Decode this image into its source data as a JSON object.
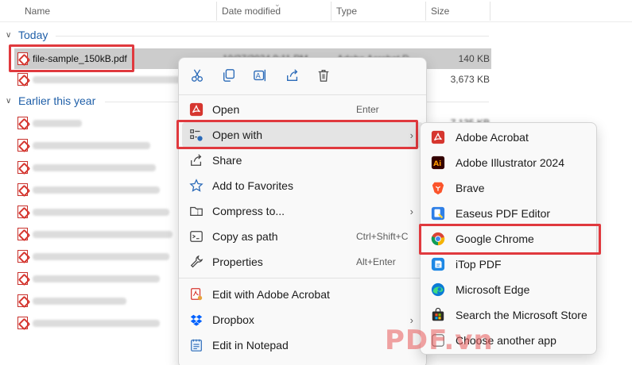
{
  "columns": {
    "name": "Name",
    "date_modified": "Date modified",
    "type": "Type",
    "size": "Size"
  },
  "groups": {
    "today": "Today",
    "earlier": "Earlier this year"
  },
  "files": {
    "selected_name": "file-sample_150kB.pdf",
    "selected_date": "10/27/2024 9:11 PM",
    "selected_type": "Adobe Acrobat D",
    "selected_size": "140 KB",
    "second_size": "3,673 KB",
    "third_size": "7,135 KB"
  },
  "quick_actions": [
    "cut-icon",
    "copy-icon",
    "rename-icon",
    "share-icon",
    "delete-icon"
  ],
  "menu": {
    "open": {
      "label": "Open",
      "shortcut": "Enter"
    },
    "open_with": {
      "label": "Open with"
    },
    "share": {
      "label": "Share"
    },
    "add_favorites": {
      "label": "Add to Favorites"
    },
    "compress": {
      "label": "Compress to..."
    },
    "copy_path": {
      "label": "Copy as path",
      "shortcut": "Ctrl+Shift+C"
    },
    "properties": {
      "label": "Properties",
      "shortcut": "Alt+Enter"
    },
    "edit_acrobat": {
      "label": "Edit with Adobe Acrobat"
    },
    "dropbox": {
      "label": "Dropbox"
    },
    "notepad": {
      "label": "Edit in Notepad"
    }
  },
  "submenu": {
    "items": [
      {
        "label": "Adobe Acrobat",
        "icon": "adobe-acrobat-icon"
      },
      {
        "label": "Adobe Illustrator 2024",
        "icon": "adobe-illustrator-icon"
      },
      {
        "label": "Brave",
        "icon": "brave-icon"
      },
      {
        "label": "Easeus PDF Editor",
        "icon": "easeus-pdf-icon"
      },
      {
        "label": "Google Chrome",
        "icon": "chrome-icon"
      },
      {
        "label": "iTop PDF",
        "icon": "itop-pdf-icon"
      },
      {
        "label": "Microsoft Edge",
        "icon": "edge-icon"
      },
      {
        "label": "Search the Microsoft Store",
        "icon": "store-icon"
      },
      {
        "label": "Choose another app",
        "icon": "apps-icon"
      }
    ]
  },
  "watermark": "PDF.vn",
  "colors": {
    "highlight": "#e0393e",
    "accent": "#1f5fa8",
    "pdf_red": "#d6362f"
  }
}
